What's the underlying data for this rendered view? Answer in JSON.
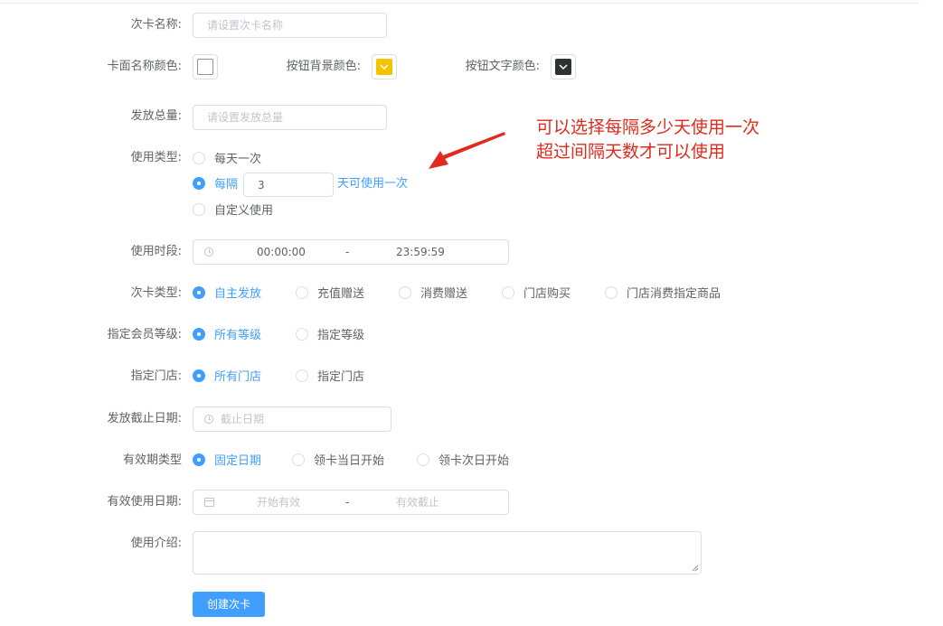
{
  "form": {
    "card_name": {
      "label": "次卡名称:",
      "placeholder": "请设置次卡名称"
    },
    "colors": {
      "name_color_label": "卡面名称颜色:",
      "btn_bg_label": "按钮背景颜色:",
      "btn_text_label": "按钮文字颜色:",
      "name_color": "#ffffff",
      "btn_bg_color": "#f5c400",
      "btn_text_color": "#303133"
    },
    "total": {
      "label": "发放总量:",
      "placeholder": "请设置发放总量"
    },
    "usage_type": {
      "label": "使用类型:",
      "options": [
        "每天一次",
        "每隔",
        "自定义使用"
      ],
      "interval_value": "3",
      "interval_suffix": "天可使用一次"
    },
    "time_range": {
      "label": "使用时段:",
      "start": "00:00:00",
      "separator": "-",
      "end": "23:59:59"
    },
    "card_type": {
      "label": "次卡类型:",
      "options": [
        "自主发放",
        "充值赠送",
        "消费赠送",
        "门店购买",
        "门店消费指定商品"
      ]
    },
    "member_level": {
      "label": "指定会员等级:",
      "options": [
        "所有等级",
        "指定等级"
      ]
    },
    "store": {
      "label": "指定门店:",
      "options": [
        "所有门店",
        "指定门店"
      ]
    },
    "deadline": {
      "label": "发放截止日期:",
      "placeholder": "截止日期"
    },
    "validity_type": {
      "label": "有效期类型",
      "options": [
        "固定日期",
        "领卡当日开始",
        "领卡次日开始"
      ]
    },
    "validity_date": {
      "label": "有效使用日期:",
      "start_placeholder": "开始有效",
      "separator": "-",
      "end_placeholder": "有效截止"
    },
    "description": {
      "label": "使用介绍:"
    },
    "submit_label": "创建次卡"
  },
  "annotation": {
    "line1": "可以选择每隔多少天使用一次",
    "line2": "超过间隔天数才可以使用",
    "color": "#e02a1e"
  },
  "accent_color": "#409eff"
}
